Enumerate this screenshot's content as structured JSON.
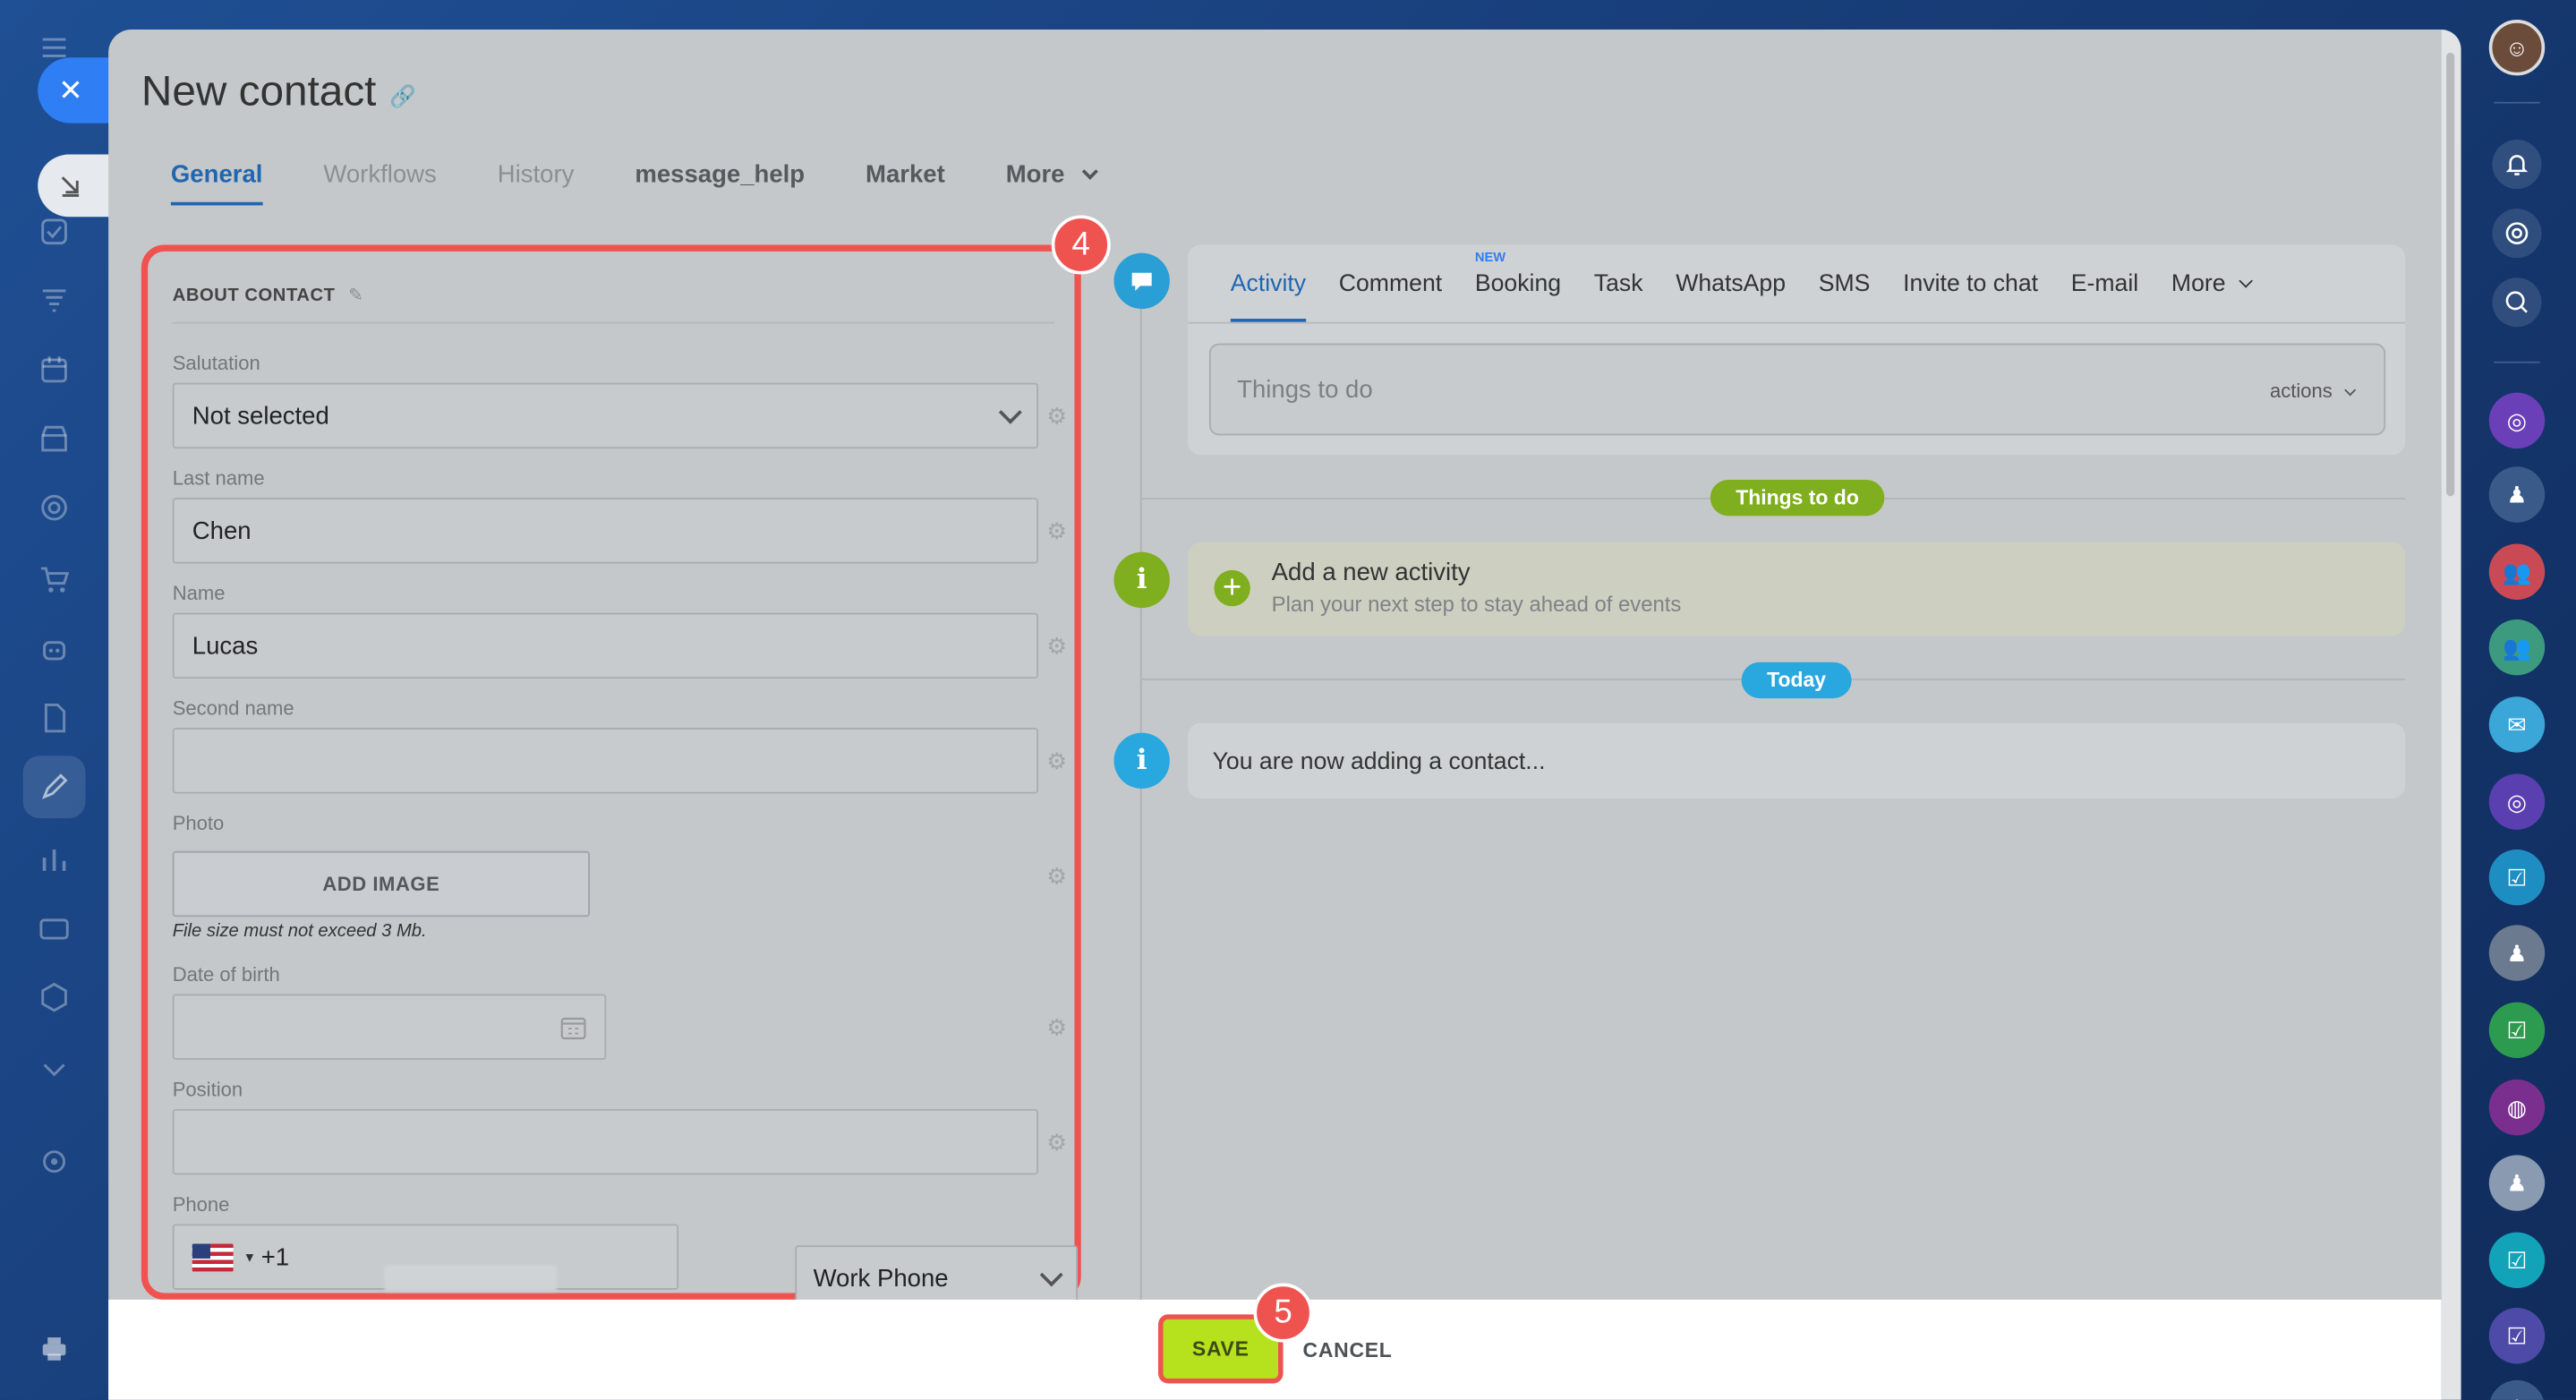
{
  "modal": {
    "title": "New contact",
    "tabs": [
      {
        "label": "General"
      },
      {
        "label": "Workflows"
      },
      {
        "label": "History"
      },
      {
        "label": "message_help"
      },
      {
        "label": "Market"
      },
      {
        "label": "More"
      }
    ]
  },
  "form": {
    "section_title": "ABOUT CONTACT",
    "salutation": {
      "label": "Salutation",
      "value": "Not selected"
    },
    "last_name": {
      "label": "Last name",
      "value": "Chen"
    },
    "name": {
      "label": "Name",
      "value": "Lucas"
    },
    "second_name": {
      "label": "Second name",
      "value": ""
    },
    "photo": {
      "label": "Photo",
      "button": "ADD IMAGE",
      "note": "File size must not exceed 3 Mb."
    },
    "date_of_birth": {
      "label": "Date of birth",
      "value": ""
    },
    "position": {
      "label": "Position",
      "value": ""
    },
    "phone": {
      "label": "Phone",
      "country_code": "+1",
      "type": "Work Phone"
    }
  },
  "activity": {
    "tabs": [
      {
        "label": "Activity"
      },
      {
        "label": "Comment"
      },
      {
        "label": "Booking",
        "badge": "NEW"
      },
      {
        "label": "Task"
      },
      {
        "label": "WhatsApp"
      },
      {
        "label": "SMS"
      },
      {
        "label": "Invite to chat"
      },
      {
        "label": "E-mail"
      },
      {
        "label": "More"
      }
    ],
    "things_to_do_placeholder": "Things to do",
    "actions_label": "actions",
    "pill_things_to_do": "Things to do",
    "add_new_title": "Add a new activity",
    "add_new_subtitle": "Plan your next step to stay ahead of events",
    "pill_today": "Today",
    "adding_message": "You are now adding a contact..."
  },
  "footer": {
    "save": "SAVE",
    "cancel": "CANCEL"
  },
  "annotations": {
    "step_form": "4",
    "step_save": "5"
  },
  "colors": {
    "accent": "#2066b0",
    "save": "#b5e21d",
    "highlight": "#ef5350",
    "pill_green": "#7fae1e",
    "pill_blue": "#29a8e0"
  }
}
